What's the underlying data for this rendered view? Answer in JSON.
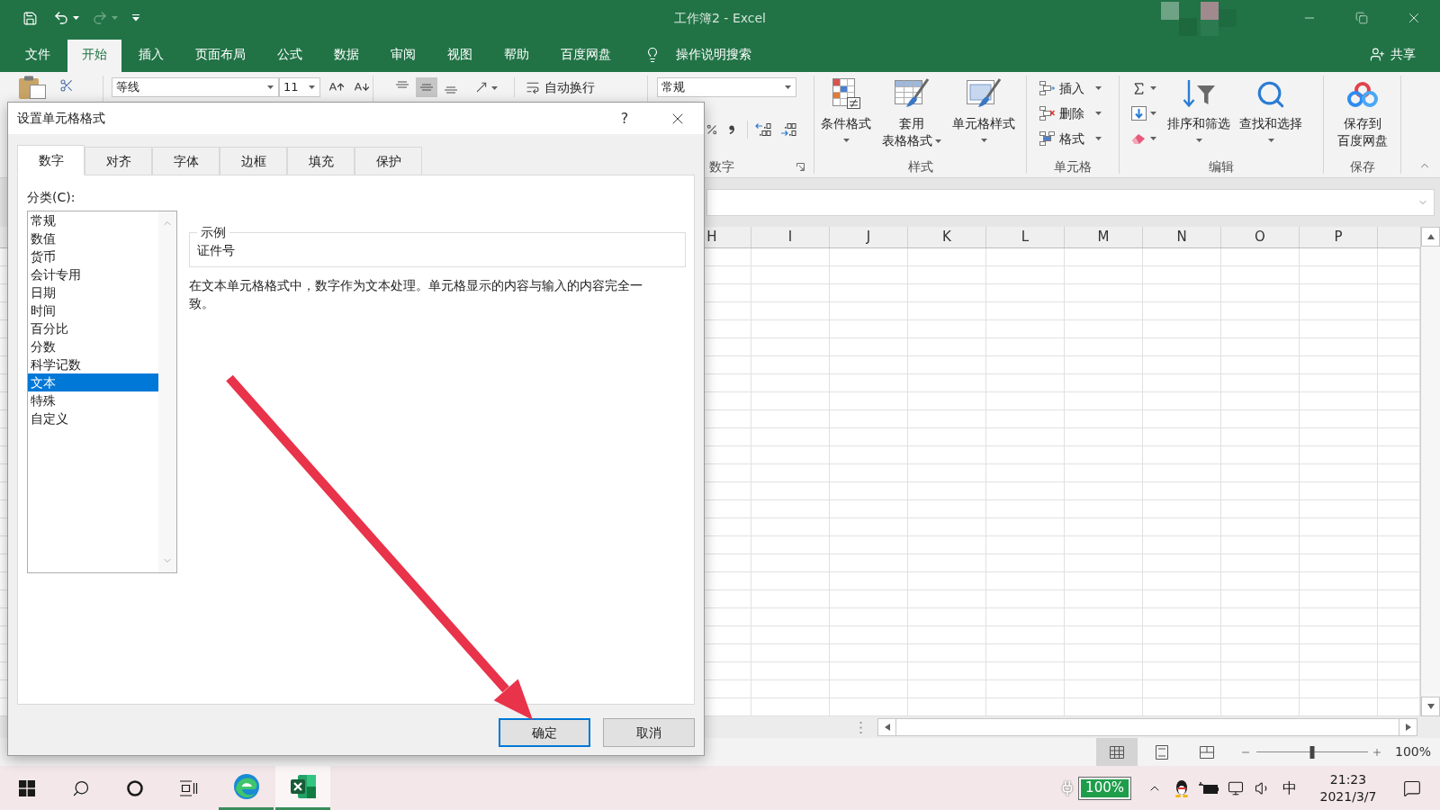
{
  "title_bar": {
    "title": "工作簿2 - Excel"
  },
  "ribbon_tabs": [
    {
      "label": "文件",
      "selected": false
    },
    {
      "label": "开始",
      "selected": true
    },
    {
      "label": "插入",
      "selected": false
    },
    {
      "label": "页面布局",
      "selected": false
    },
    {
      "label": "公式",
      "selected": false
    },
    {
      "label": "数据",
      "selected": false
    },
    {
      "label": "审阅",
      "selected": false
    },
    {
      "label": "视图",
      "selected": false
    },
    {
      "label": "帮助",
      "selected": false
    },
    {
      "label": "百度网盘",
      "selected": false
    }
  ],
  "tell_me": {
    "label": "操作说明搜索"
  },
  "share_button": {
    "label": "共享"
  },
  "ribbon": {
    "font_name": "等线",
    "font_size": "11",
    "vertical_alignment": [
      {
        "selected": false
      },
      {
        "selected": true
      },
      {
        "selected": false
      }
    ],
    "wrap_text": "自动换行",
    "number_format": "常规",
    "number_group_label": "数字",
    "styles": {
      "label": "样式",
      "buttons": [
        {
          "lines": [
            "条件格式"
          ],
          "dropdown": true
        },
        {
          "lines": [
            "套用",
            "表格格式"
          ],
          "dropdown": true
        },
        {
          "lines": [
            "单元格样式"
          ],
          "dropdown": true
        }
      ]
    },
    "cells": {
      "label": "单元格",
      "buttons": [
        {
          "label": "插入",
          "dropdown": true
        },
        {
          "label": "删除",
          "dropdown": true
        },
        {
          "label": "格式",
          "dropdown": true
        }
      ]
    },
    "editing": {
      "label": "编辑",
      "buttons": [
        {
          "lines": [
            "排序和筛选"
          ],
          "dropdown": true
        },
        {
          "lines": [
            "查找和选择"
          ],
          "dropdown": true
        }
      ]
    },
    "save": {
      "label": "保存",
      "buttons": [
        {
          "lines": [
            "保存到",
            "百度网盘"
          ],
          "dropdown": false
        }
      ]
    }
  },
  "sheet": {
    "columns": [
      "H",
      "I",
      "J",
      "K",
      "L",
      "M",
      "N",
      "O",
      "P"
    ]
  },
  "status_bar": {
    "views": [
      {
        "selected": true
      },
      {
        "selected": false
      },
      {
        "selected": false
      }
    ],
    "zoom": {
      "level": 0.5,
      "reading": "100%"
    }
  },
  "dialog": {
    "title": "设置单元格格式",
    "help": "?",
    "tabs": [
      {
        "label": "数字",
        "selected": true
      },
      {
        "label": "对齐",
        "selected": false
      },
      {
        "label": "字体",
        "selected": false
      },
      {
        "label": "边框",
        "selected": false
      },
      {
        "label": "填充",
        "selected": false
      },
      {
        "label": "保护",
        "selected": false
      }
    ],
    "category_label": "分类(C):",
    "categories": [
      {
        "label": "常规",
        "selected": false
      },
      {
        "label": "数值",
        "selected": false
      },
      {
        "label": "货币",
        "selected": false
      },
      {
        "label": "会计专用",
        "selected": false
      },
      {
        "label": "日期",
        "selected": false
      },
      {
        "label": "时间",
        "selected": false
      },
      {
        "label": "百分比",
        "selected": false
      },
      {
        "label": "分数",
        "selected": false
      },
      {
        "label": "科学记数",
        "selected": false
      },
      {
        "label": "文本",
        "selected": true
      },
      {
        "label": "特殊",
        "selected": false
      },
      {
        "label": "自定义",
        "selected": false
      }
    ],
    "sample": {
      "label": "示例",
      "value": "证件号"
    },
    "description": "在文本单元格格式中，数字作为文本处理。单元格显示的内容与输入的内容完全一致。",
    "buttons": [
      {
        "label": "确定",
        "kind": "default"
      },
      {
        "label": "取消",
        "kind": "normal"
      }
    ]
  },
  "taskbar": {
    "apps": [
      {
        "selected": false
      },
      {
        "selected": true
      }
    ],
    "battery": "100%",
    "ime": "中",
    "time": "21:23",
    "date": "2021/3/7"
  }
}
